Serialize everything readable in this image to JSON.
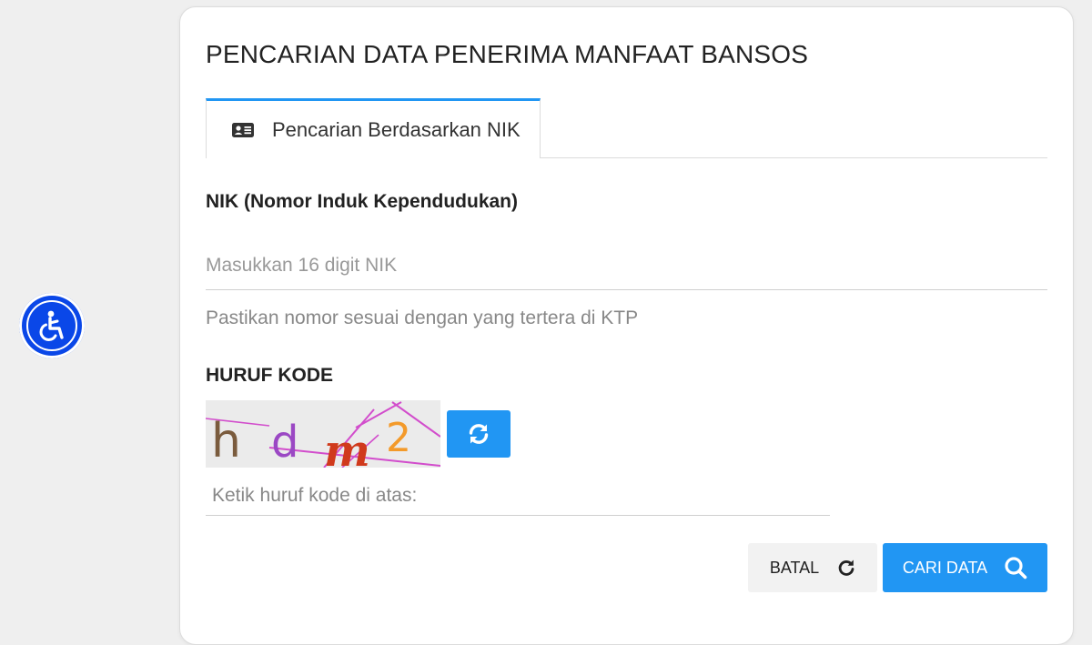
{
  "accessibility": {
    "icon": "accessibility-icon",
    "color": "#0a47e8"
  },
  "card": {
    "title": "PENCARIAN DATA PENERIMA MANFAAT BANSOS"
  },
  "tabs": [
    {
      "label": "Pencarian Berdasarkan NIK",
      "icon": "id-card-icon",
      "active": true
    }
  ],
  "nik_field": {
    "label": "NIK (Nomor Induk Kependudukan)",
    "placeholder": "Masukkan 16 digit NIK",
    "value": "",
    "helper": "Pastikan nomor sesuai dengan yang tertera di KTP"
  },
  "captcha": {
    "label": "HURUF KODE",
    "chars": [
      "h",
      "d",
      "m",
      "2"
    ],
    "refresh_icon": "refresh-icon",
    "input_placeholder": "Ketik huruf kode di atas:",
    "input_value": ""
  },
  "actions": {
    "cancel_label": "BATAL",
    "cancel_icon": "reset-icon",
    "search_label": "CARI DATA",
    "search_icon": "search-icon"
  },
  "colors": {
    "primary": "#2196f3",
    "background": "#efefef"
  }
}
